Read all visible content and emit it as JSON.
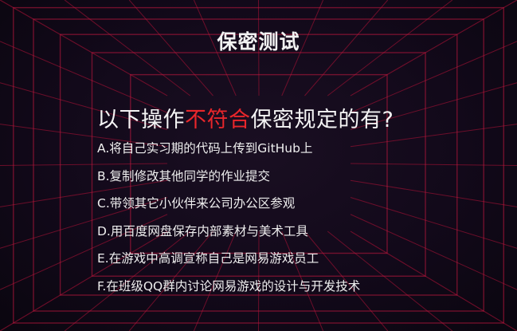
{
  "slide": {
    "title": "保密测试",
    "question_before": "以下操作",
    "question_highlight": "不符合",
    "question_after": "保密规定的有?",
    "options": [
      "A.将自己实习期的代码上传到GitHub上",
      "B.复制修改其他同学的作业提交",
      "C.带领其它小伙伴来公司办公区参观",
      "D.用百度网盘保存内部素材与美术工具",
      "E.在游戏中高调宣称自己是网易游戏员工",
      "F.在班级QQ群内讨论网易游戏的设计与开发技术"
    ]
  },
  "colors": {
    "background": "#0d0913",
    "grid_line": "#8a1030",
    "highlight": "#e8262b",
    "text": "#f2f2f2"
  }
}
